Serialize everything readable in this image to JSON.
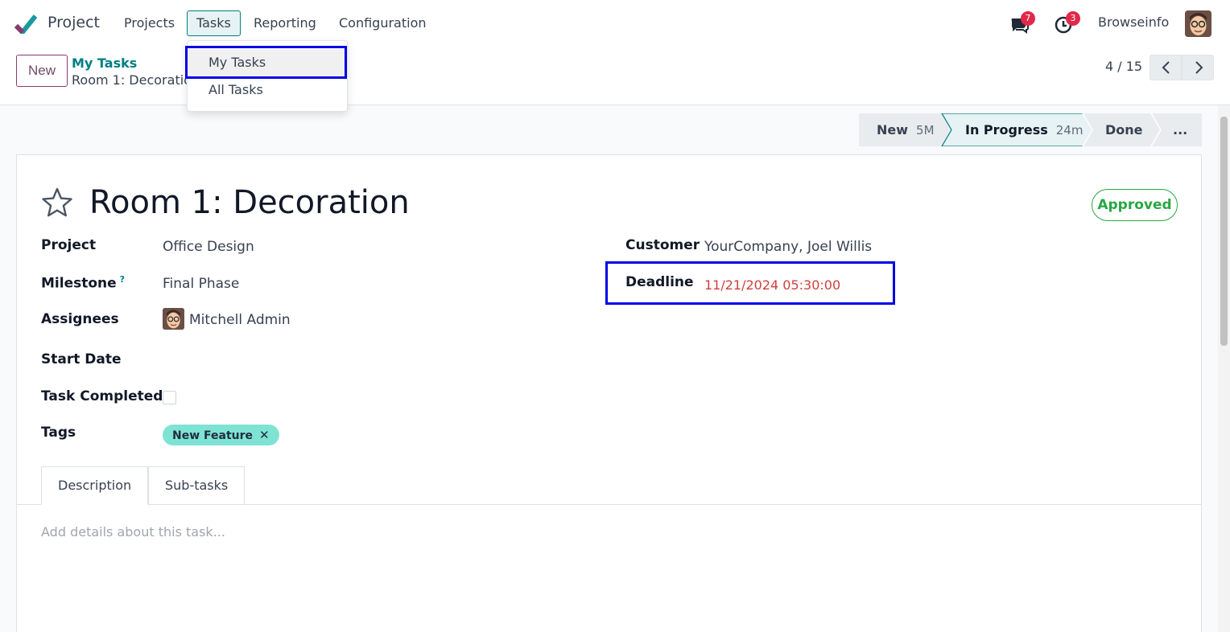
{
  "navbar": {
    "app_name": "Project",
    "menus": [
      "Projects",
      "Tasks",
      "Reporting",
      "Configuration"
    ],
    "active_menu": "Tasks",
    "messages_count": "7",
    "activities_count": "3",
    "company": "Browseinfo"
  },
  "tasks_dropdown": {
    "items": [
      "My Tasks",
      "All Tasks"
    ]
  },
  "control_panel": {
    "new_label": "New",
    "breadcrumb_parent": "My Tasks",
    "breadcrumb_current": "Room 1: Decoration",
    "pager": "4 / 15"
  },
  "status_bar": {
    "stages": [
      {
        "label": "New",
        "duration": "5M"
      },
      {
        "label": "In Progress",
        "duration": "24m"
      },
      {
        "label": "Done",
        "duration": ""
      },
      {
        "label": "...",
        "duration": ""
      }
    ],
    "current": "In Progress"
  },
  "task": {
    "title": "Room 1: Decoration",
    "status": "Approved",
    "fields": {
      "project_label": "Project",
      "project": "Office Design",
      "milestone_label": "Milestone",
      "milestone_help": "?",
      "milestone": "Final Phase",
      "assignees_label": "Assignees",
      "assignee": "Mitchell Admin",
      "start_date_label": "Start Date",
      "task_completed_label": "Task Completed",
      "tags_label": "Tags",
      "tag": "New Feature",
      "customer_label": "Customer",
      "customer": "YourCompany, Joel Willis",
      "deadline_label": "Deadline",
      "deadline": "11/21/2024 05:30:00"
    },
    "tabs": [
      "Description",
      "Sub-tasks"
    ],
    "description_placeholder": "Add details about this task..."
  },
  "colors": {
    "brand_teal": "#017e84",
    "primary_purple": "#714b67",
    "deadline_red": "#d23f3a",
    "approved_green": "#28a745",
    "highlight_blue": "#0000e6",
    "tag_bg": "#7fe3d4"
  }
}
